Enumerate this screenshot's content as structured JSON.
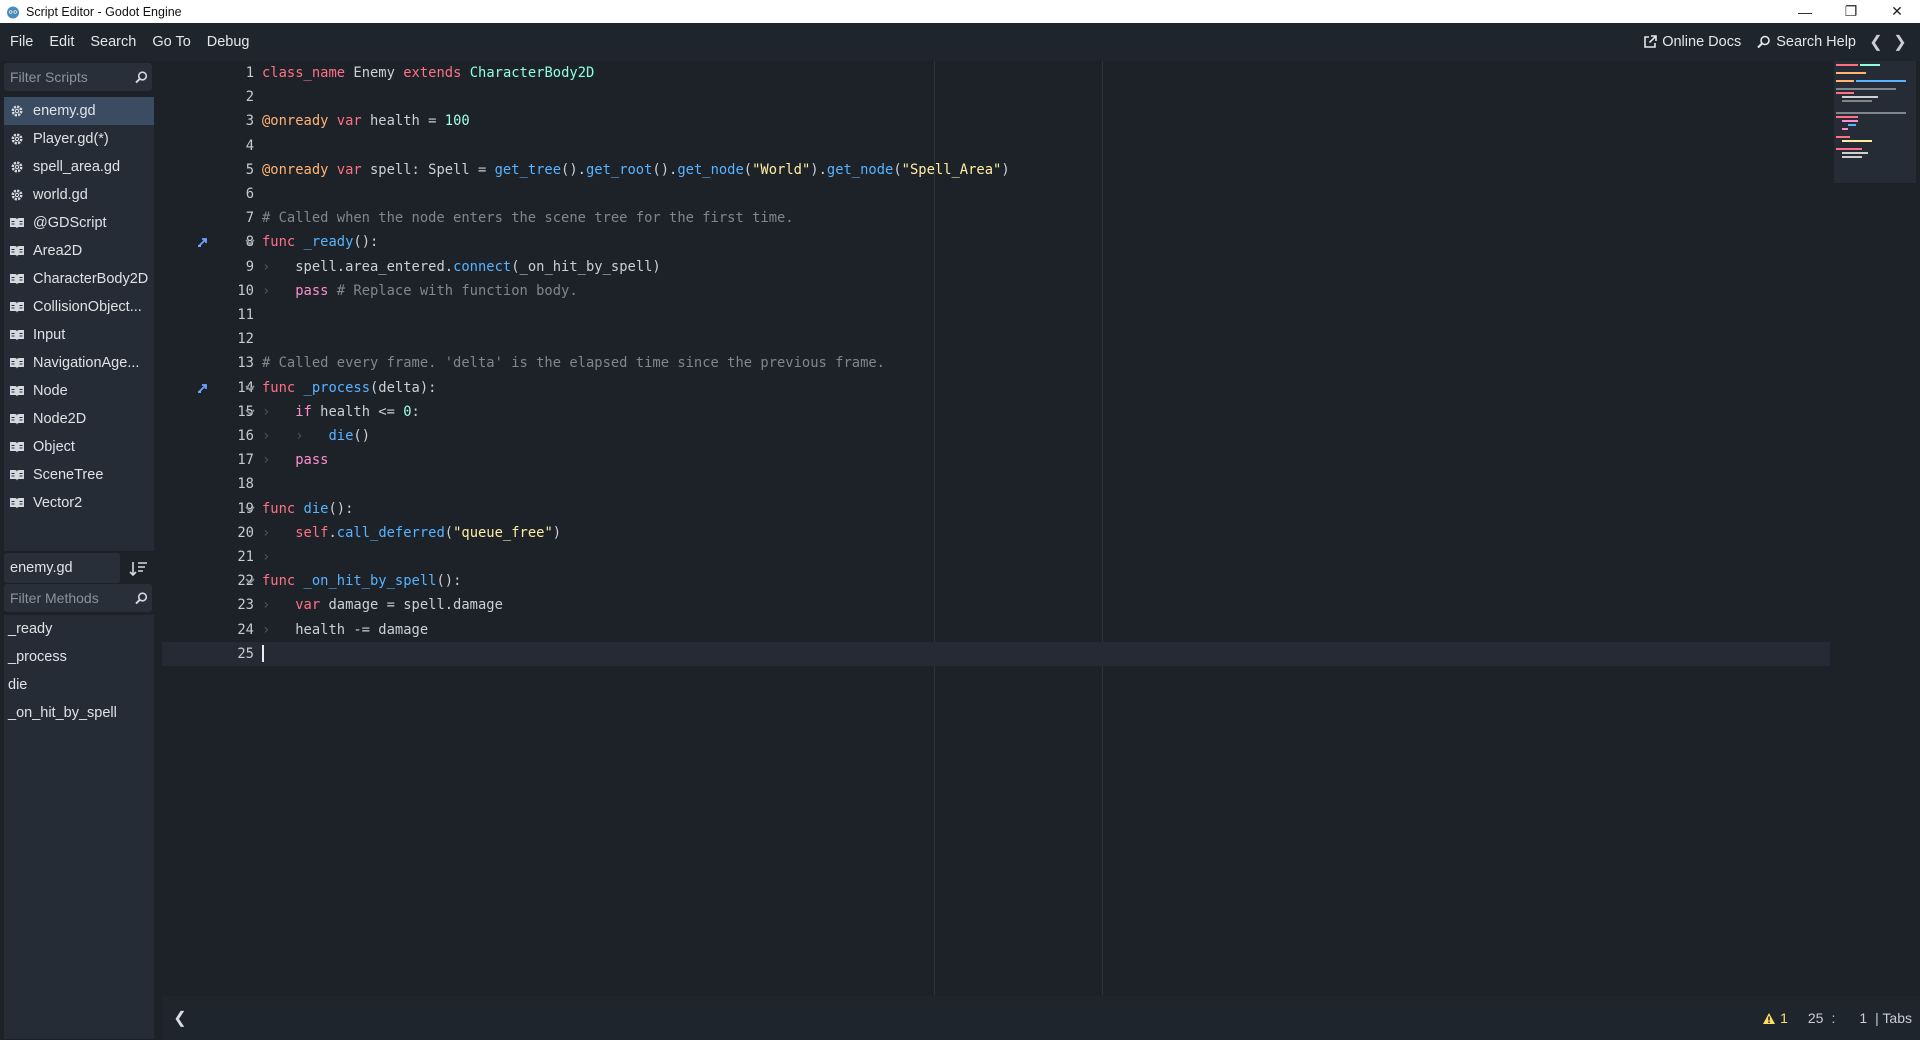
{
  "window": {
    "title": "Script Editor - Godot Engine"
  },
  "menu": [
    "File",
    "Edit",
    "Search",
    "Go To",
    "Debug"
  ],
  "top_right": {
    "online_docs": "Online Docs",
    "search_help": "Search Help"
  },
  "sidebar": {
    "filter_scripts_placeholder": "Filter Scripts",
    "scripts": [
      {
        "label": "enemy.gd",
        "icon": "gear-icon",
        "active": true
      },
      {
        "label": "Player.gd(*)",
        "icon": "gear-icon"
      },
      {
        "label": "spell_area.gd",
        "icon": "gear-icon"
      },
      {
        "label": "world.gd",
        "icon": "gear-icon"
      },
      {
        "label": "@GDScript",
        "icon": "doc-icon"
      },
      {
        "label": "Area2D",
        "icon": "doc-icon"
      },
      {
        "label": "CharacterBody2D",
        "icon": "doc-icon"
      },
      {
        "label": "CollisionObject...",
        "icon": "doc-icon"
      },
      {
        "label": "Input",
        "icon": "doc-icon"
      },
      {
        "label": "NavigationAge...",
        "icon": "doc-icon"
      },
      {
        "label": "Node",
        "icon": "doc-icon"
      },
      {
        "label": "Node2D",
        "icon": "doc-icon"
      },
      {
        "label": "Object",
        "icon": "doc-icon"
      },
      {
        "label": "SceneTree",
        "icon": "doc-icon"
      },
      {
        "label": "Vector2",
        "icon": "doc-icon"
      }
    ],
    "current_script": "enemy.gd",
    "filter_methods_placeholder": "Filter Methods",
    "methods": [
      "_ready",
      "_process",
      "die",
      "_on_hit_by_spell"
    ]
  },
  "editor": {
    "lines": [
      {
        "n": "1",
        "tokens": [
          [
            "kw",
            "class_name"
          ],
          [
            "",
            "Enemy"
          ],
          [
            "kw",
            "extends"
          ],
          [
            "ty",
            "CharacterBody2D"
          ]
        ],
        "spaced": true
      },
      {
        "n": "2",
        "tokens": []
      },
      {
        "n": "3",
        "tokens": [
          [
            "ann",
            "@onready"
          ],
          [
            "kw",
            " var"
          ],
          [
            "",
            " health = "
          ],
          [
            "num",
            "100"
          ]
        ]
      },
      {
        "n": "4",
        "tokens": []
      },
      {
        "n": "5",
        "tokens": [
          [
            "ann",
            "@onready"
          ],
          [
            "kw",
            " var"
          ],
          [
            "",
            " spell: "
          ],
          [
            "ty",
            ""
          ],
          [
            "",
            "Spell = "
          ],
          [
            "fn",
            "get_tree"
          ],
          [
            "",
            "()."
          ],
          [
            "fn",
            "get_root"
          ],
          [
            "",
            "()."
          ],
          [
            "fn",
            "get_node"
          ],
          [
            "",
            "("
          ],
          [
            "str",
            "\"World\""
          ],
          [
            "",
            ")."
          ],
          [
            "fn",
            "get_node"
          ],
          [
            "",
            "("
          ],
          [
            "str",
            "\"Spell_Area\""
          ],
          [
            "",
            ")"
          ]
        ]
      },
      {
        "n": "6",
        "tokens": []
      },
      {
        "n": "7",
        "tokens": [
          [
            "cm",
            "# Called when the node enters the scene tree for the first time."
          ]
        ]
      },
      {
        "n": "8",
        "tokens": [
          [
            "kw",
            "func"
          ],
          [
            "",
            " "
          ],
          [
            "fn",
            "_ready"
          ],
          [
            "",
            "():"
          ]
        ],
        "fold": true,
        "override": true
      },
      {
        "n": "9",
        "tabs": 1,
        "tokens": [
          [
            "",
            "spell.area_entered."
          ],
          [
            "fn",
            "connect"
          ],
          [
            "",
            "(_on_hit_by_spell)"
          ]
        ]
      },
      {
        "n": "10",
        "tabs": 1,
        "tokens": [
          [
            "ctrl",
            "pass"
          ],
          [
            "cm",
            " # Replace with function body."
          ]
        ]
      },
      {
        "n": "11",
        "tokens": []
      },
      {
        "n": "12",
        "tokens": []
      },
      {
        "n": "13",
        "tokens": [
          [
            "cm",
            "# Called every frame. 'delta' is the elapsed time since the previous frame."
          ]
        ]
      },
      {
        "n": "14",
        "tokens": [
          [
            "kw",
            "func"
          ],
          [
            "",
            " "
          ],
          [
            "fn",
            "_process"
          ],
          [
            "",
            "(delta):"
          ]
        ],
        "fold": true,
        "override": true
      },
      {
        "n": "15",
        "tabs": 1,
        "tokens": [
          [
            "ctrl",
            "if"
          ],
          [
            "",
            " health <= "
          ],
          [
            "num",
            "0"
          ],
          [
            "",
            ":"
          ]
        ],
        "fold": true
      },
      {
        "n": "16",
        "tabs": 2,
        "tokens": [
          [
            "fn",
            "die"
          ],
          [
            "",
            "()"
          ]
        ]
      },
      {
        "n": "17",
        "tabs": 1,
        "tokens": [
          [
            "ctrl",
            "pass"
          ]
        ]
      },
      {
        "n": "18",
        "tokens": []
      },
      {
        "n": "19",
        "tokens": [
          [
            "kw",
            "func"
          ],
          [
            "",
            " "
          ],
          [
            "fn",
            "die"
          ],
          [
            "",
            "():"
          ]
        ],
        "fold": true
      },
      {
        "n": "20",
        "tabs": 1,
        "tokens": [
          [
            "kw",
            "self"
          ],
          [
            "",
            "."
          ],
          [
            "fn",
            "call_deferred"
          ],
          [
            "",
            "("
          ],
          [
            "str",
            "\"queue_free\""
          ],
          [
            "",
            ")"
          ]
        ]
      },
      {
        "n": "21",
        "tabs": 1,
        "tokens": []
      },
      {
        "n": "22",
        "tokens": [
          [
            "kw",
            "func"
          ],
          [
            "",
            " "
          ],
          [
            "fn",
            "_on_hit_by_spell"
          ],
          [
            "",
            "():"
          ]
        ],
        "fold": true
      },
      {
        "n": "23",
        "tabs": 1,
        "tokens": [
          [
            "kw",
            "var"
          ],
          [
            "",
            " damage = spell.damage"
          ]
        ]
      },
      {
        "n": "24",
        "tabs": 1,
        "tokens": [
          [
            "",
            "health -= damage"
          ]
        ]
      },
      {
        "n": "25",
        "tokens": [],
        "current": true
      }
    ]
  },
  "status": {
    "warnings": "1",
    "line": "25",
    "separator": ":",
    "column": "1",
    "indent": "| Tabs"
  },
  "colors": {
    "accent": "#3a4b62",
    "keyword": "#ff7085",
    "function": "#57b3ff",
    "string": "#ffeda1",
    "comment": "#80868e"
  }
}
